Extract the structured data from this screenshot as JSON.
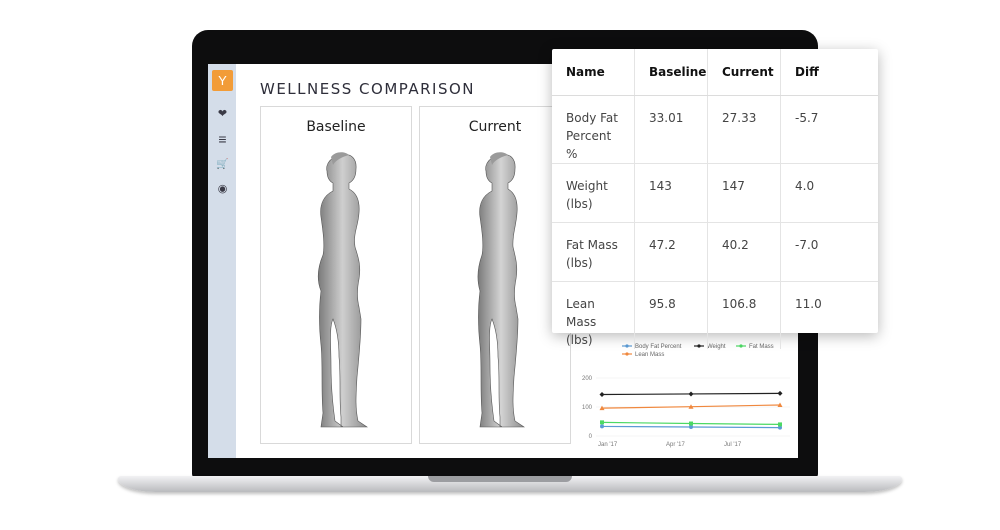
{
  "sidebar": {
    "items": [
      {
        "icon": "logo-icon",
        "glyph": "Y"
      },
      {
        "icon": "heart-pulse-icon",
        "glyph": "❤"
      },
      {
        "icon": "list-icon",
        "glyph": "≡"
      },
      {
        "icon": "cart-icon",
        "glyph": "🛒"
      },
      {
        "icon": "user-icon",
        "glyph": "◉"
      }
    ]
  },
  "page": {
    "title": "WELLNESS COMPARISON"
  },
  "panels": {
    "baseline_label": "Baseline",
    "current_label": "Current"
  },
  "table": {
    "headers": [
      "Name",
      "Baseline",
      "Current",
      "Diff"
    ],
    "rows": [
      {
        "name": "Body Fat Percent %",
        "baseline": "33.01",
        "current": "27.33",
        "diff": "-5.7"
      },
      {
        "name": "Weight (lbs)",
        "baseline": "143",
        "current": "147",
        "diff": "4.0"
      },
      {
        "name": "Fat Mass (lbs)",
        "baseline": "47.2",
        "current": "40.2",
        "diff": "-7.0"
      },
      {
        "name": "Lean Mass (lbs)",
        "baseline": "95.8",
        "current": "106.8",
        "diff": "11.0"
      }
    ]
  },
  "chart_data": {
    "type": "line",
    "x": [
      "Jan '17",
      "Apr '17",
      "Jul '17"
    ],
    "ylim": [
      0,
      200
    ],
    "yticks": [
      "200",
      "100",
      "0"
    ],
    "legend_position": "top",
    "series": [
      {
        "name": "Body Fat Percent",
        "color": "#5b9bd5",
        "marker": "circle",
        "values": [
          33,
          31,
          29
        ]
      },
      {
        "name": "Weight",
        "color": "#222222",
        "marker": "diamond",
        "values": [
          143,
          145,
          147
        ]
      },
      {
        "name": "Fat Mass",
        "color": "#4cd964",
        "marker": "square",
        "values": [
          47,
          43,
          40
        ]
      },
      {
        "name": "Lean Mass",
        "color": "#f0883e",
        "marker": "triangle",
        "values": [
          96,
          101,
          107
        ]
      }
    ],
    "colors": {
      "accent": "#f29c38",
      "sidebar": "#d4dde9"
    }
  }
}
